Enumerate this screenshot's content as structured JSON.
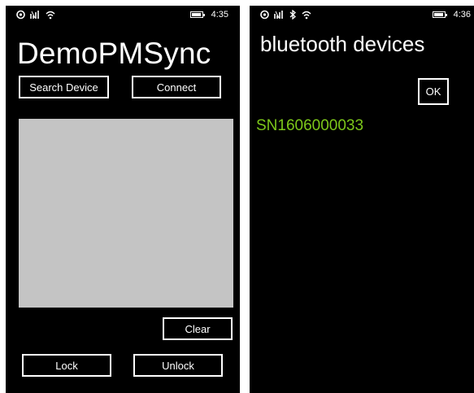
{
  "left_screen": {
    "status_bar": {
      "time": "4:35",
      "battery_level": 0.75
    },
    "title": "DemoPMSync",
    "buttons": {
      "search_device": "Search Device",
      "connect": "Connect",
      "clear": "Clear",
      "lock": "Lock",
      "unlock": "Unlock"
    },
    "log_area": {
      "text": ""
    }
  },
  "right_screen": {
    "status_bar": {
      "time": "4:36",
      "battery_level": 0.75
    },
    "title": "bluetooth devices",
    "ok_label": "OK",
    "devices": [
      "SN1606000033"
    ]
  },
  "colors": {
    "background": "#000000",
    "foreground": "#ffffff",
    "accent_green": "#7cc71a",
    "log_area": "#c4c4c4"
  },
  "icons": [
    "location-icon",
    "signal-bars-icon",
    "wifi-icon",
    "bluetooth-icon",
    "battery-icon"
  ]
}
